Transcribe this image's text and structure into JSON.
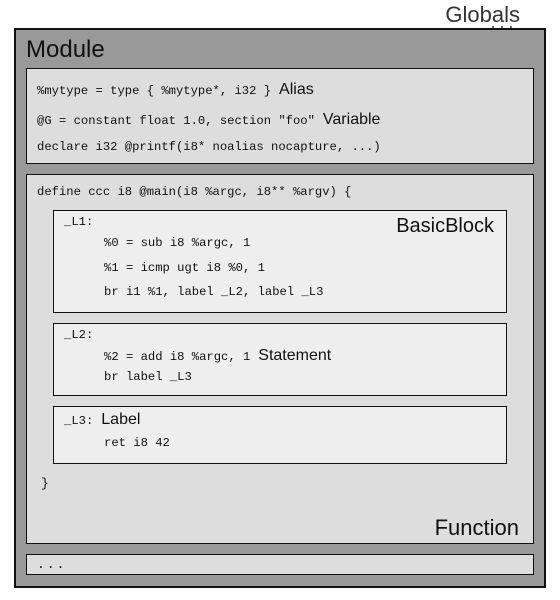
{
  "globals_label": "Globals",
  "module": {
    "title": "Module",
    "declarations": {
      "line1": {
        "code": "%mytype = type { %mytype*, i32 }",
        "annotation": "Alias"
      },
      "line2": {
        "code": "@G = constant float 1.0, section \"foo\"",
        "annotation": "Variable"
      },
      "line3": {
        "code": "declare i32 @printf(i8* noalias nocapture, ...)"
      }
    },
    "function": {
      "signature": "define ccc i8 @main(i8 %argc, i8** %argv) {",
      "title": "Function",
      "blocks": [
        {
          "label": "_L1:",
          "title": "BasicBlock",
          "body": [
            "%0 = sub i8 %argc, 1",
            "%1 = icmp ugt i8 %0, 1",
            "br i1 %1, label _L2, label _L3"
          ]
        },
        {
          "label": "_L2:",
          "body": [
            "%2 = add i8 %argc, 1",
            "br label _L3"
          ],
          "inline_annotation": "Statement"
        },
        {
          "label": "_L3:",
          "label_annotation": "Label",
          "body": [
            "ret i8 42"
          ]
        }
      ],
      "close": "}"
    },
    "ellipsis": "..."
  }
}
